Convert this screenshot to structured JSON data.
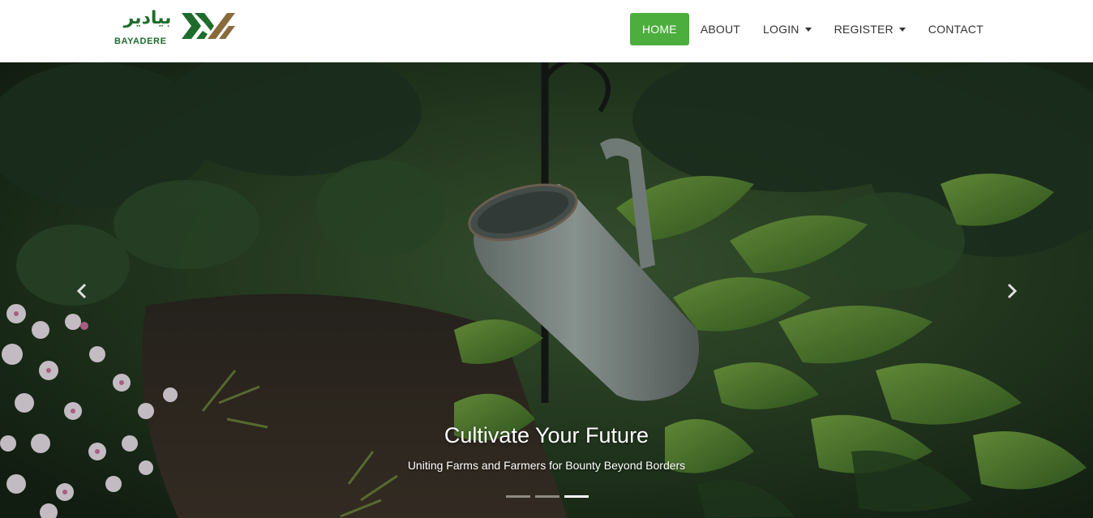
{
  "brand": {
    "arabic_name": "بيادير",
    "latin_name": "BAYADERE",
    "colors": {
      "green": "#1f6b2c",
      "brown": "#8a6a3b"
    }
  },
  "nav": {
    "items": [
      {
        "label": "HOME",
        "active": true,
        "dropdown": false
      },
      {
        "label": "ABOUT",
        "active": false,
        "dropdown": false
      },
      {
        "label": "LOGIN",
        "active": false,
        "dropdown": true
      },
      {
        "label": "REGISTER",
        "active": false,
        "dropdown": true
      },
      {
        "label": "CONTACT",
        "active": false,
        "dropdown": false
      }
    ],
    "active_color": "#4cae3d"
  },
  "carousel": {
    "title": "Cultivate Your Future",
    "subtitle": "Uniting Farms and Farmers for Bounty Beyond Borders",
    "prev_icon": "chevron-left-icon",
    "next_icon": "chevron-right-icon",
    "slide_count": 3,
    "active_slide": 3
  }
}
